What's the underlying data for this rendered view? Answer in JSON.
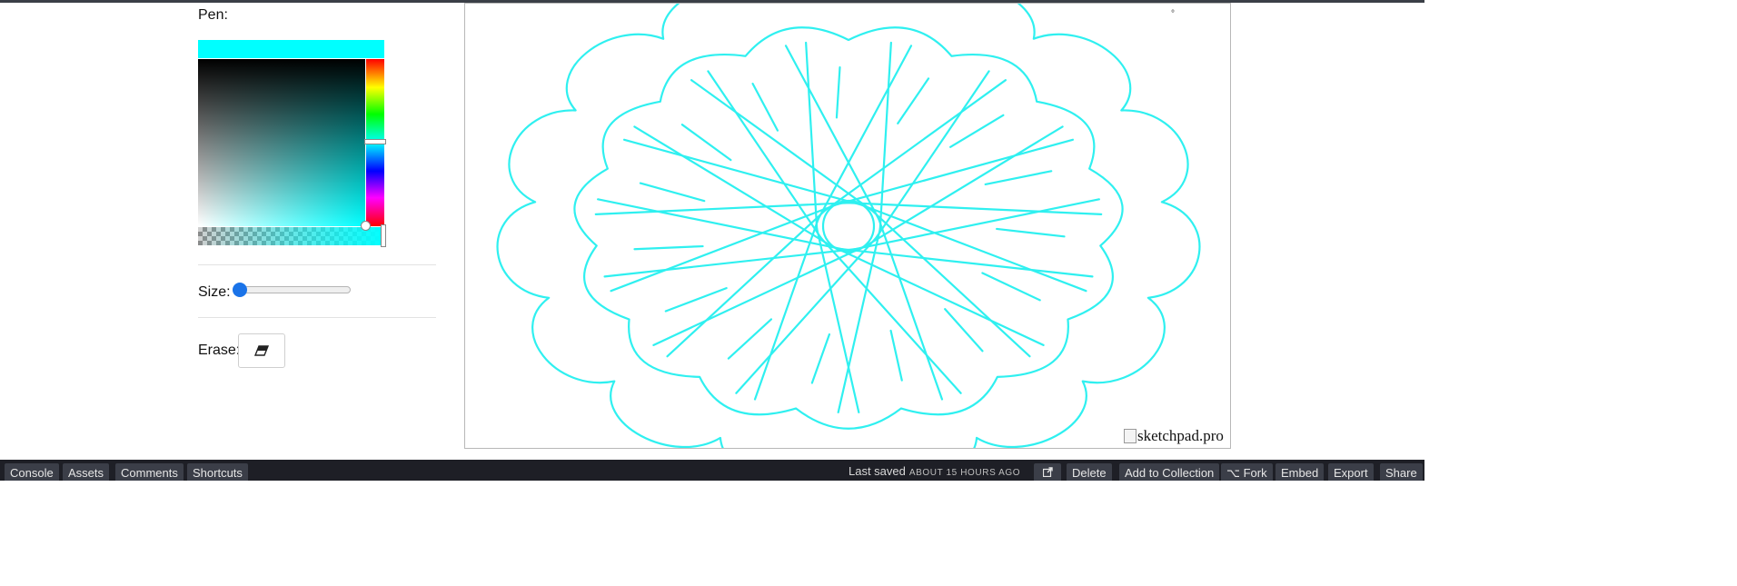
{
  "controls": {
    "pen_label": "Pen:",
    "size_label": "Size:",
    "erase_label": "Erase:",
    "pen_color": "#00ffff",
    "size_value": 0
  },
  "canvas": {
    "stroke_color": "#2ff0f0",
    "corner_mark": "°",
    "broken_image_alt": "sketchpad.pro"
  },
  "footer": {
    "left_tabs": [
      "Console",
      "Assets",
      "Comments",
      "Shortcuts"
    ],
    "last_saved_label": "Last saved",
    "last_saved_time": "ABOUT 15 HOURS AGO",
    "right_buttons": [
      "Delete",
      "Add to Collection",
      "Fork",
      "Embed",
      "Export",
      "Share"
    ],
    "fork_icon": "fork-icon",
    "external_icon": "external-link-icon"
  }
}
